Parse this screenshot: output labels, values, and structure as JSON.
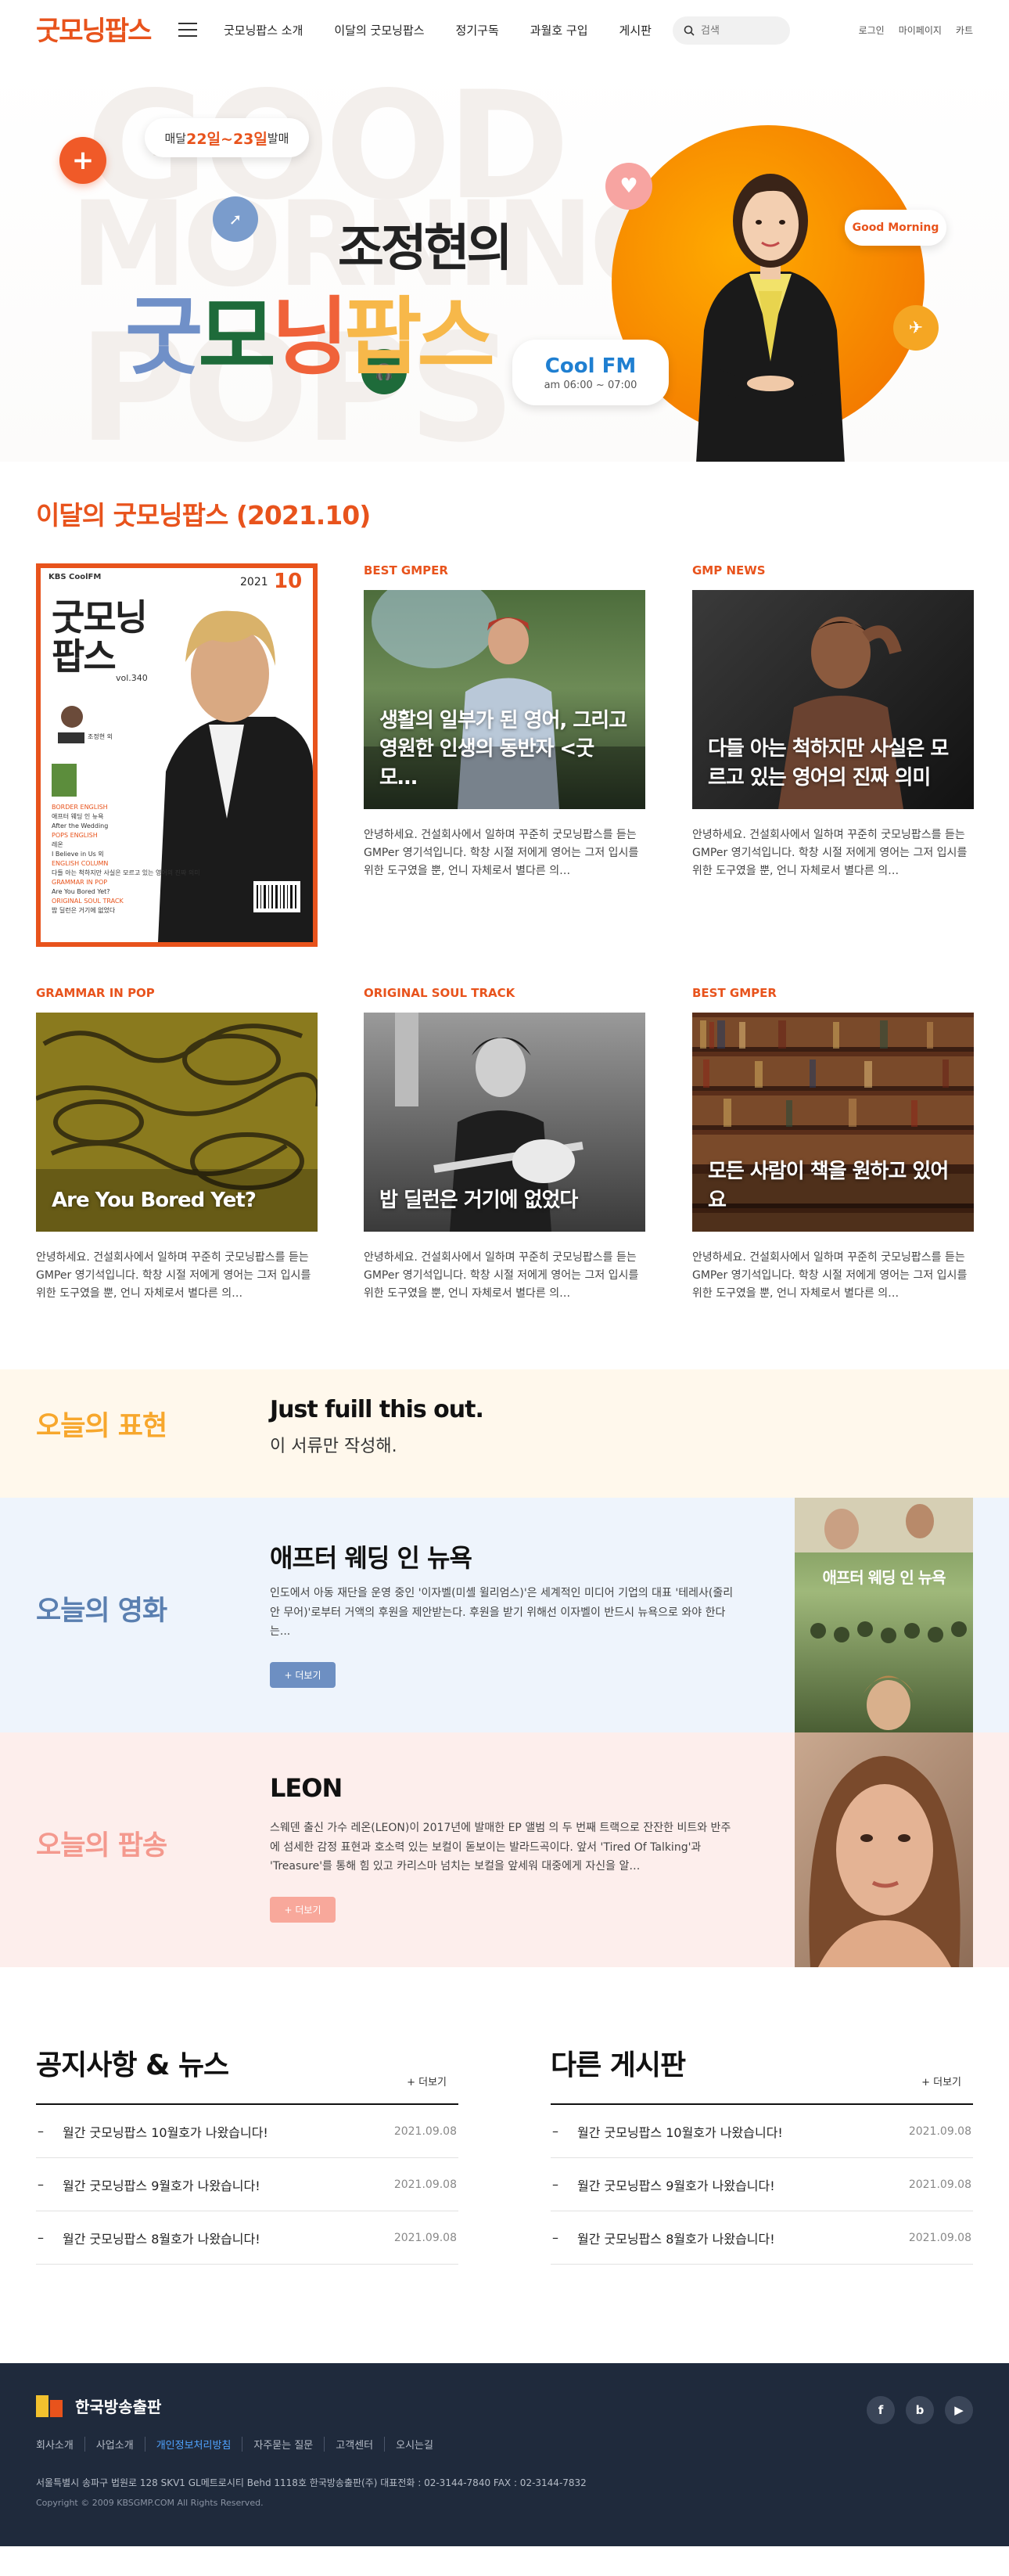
{
  "header": {
    "logo": "굿모닝팝스",
    "nav": [
      "굿모닝팝스 소개",
      "이달의 굿모닝팝스",
      "정기구독",
      "과월호 구입",
      "게시판"
    ],
    "search_placeholder": "검색",
    "util": [
      "로그인",
      "마이페이지",
      "카트"
    ]
  },
  "hero": {
    "badge_prefix": "매달 ",
    "badge_dates": "22일~23일",
    "badge_suffix": " 발매",
    "host_title": "조정현의",
    "show_title_1": "굿",
    "show_title_2": "모",
    "show_title_3": "닝",
    "show_title_4": "팝스",
    "good_morning": "Good Morning",
    "station": "Cool FM",
    "time": "am 06:00 ~ 07:00",
    "bg_words": [
      "GOOD",
      "MORNING",
      "POPS"
    ]
  },
  "monthly": {
    "title": "이달의 굿모닝팝스 (2021.10)",
    "magazine": {
      "kbs": "KBS CoolFM",
      "year": "2021",
      "month": "10",
      "title_1": "굿모닝",
      "title_2": "팝스",
      "vol": "vol.340",
      "host": "조정현 외",
      "toc": [
        "BORDER ENGLISH",
        "애프터 웨딩 인 뉴욕",
        "After the Wedding",
        "POPS ENGLISH",
        "레온",
        "I Believe in Us 외",
        "ENGLISH COLUMN",
        "다들 아는 척하지만 사실은 모르고 있는 영어의 진짜 의미",
        "GRAMMAR IN POP",
        "Are You Bored Yet?",
        "ORIGINAL SOUL TRACK",
        "밥 딜런은 거기에 없었다"
      ]
    },
    "cards": [
      {
        "category": "BEST GMPER",
        "caption": "생활의 일부가 된 영어, 그리고 영원한 인생의 동반자 <굿모…",
        "desc": "안녕하세요. 건설회사에서 일하며 꾸준히 굿모닝팝스를 듣는 GMPer 영기석입니다. 학창 시절 저에게 영어는 그저 입시를 위한 도구였을 뿐, 언니 자체로서 별다른 의…"
      },
      {
        "category": "GMP NEWS",
        "caption": "다들 아는 척하지만 사실은 모르고 있는 영어의 진짜 의미",
        "desc": "안녕하세요. 건설회사에서 일하며 꾸준히 굿모닝팝스를 듣는 GMPer 영기석입니다. 학창 시절 저에게 영어는 그저 입시를 위한 도구였을 뿐, 언니 자체로서 별다른 의…"
      },
      {
        "category": "GRAMMAR IN POP",
        "caption": "Are You Bored Yet?",
        "desc": "안녕하세요. 건설회사에서 일하며 꾸준히 굿모닝팝스를 듣는 GMPer 영기석입니다. 학창 시절 저에게 영어는 그저 입시를 위한 도구였을 뿐, 언니 자체로서 별다른 의…"
      },
      {
        "category": "ORIGINAL SOUL TRACK",
        "caption": "밥 딜런은 거기에 없었다",
        "desc": "안녕하세요. 건설회사에서 일하며 꾸준히 굿모닝팝스를 듣는 GMPer 영기석입니다. 학창 시절 저에게 영어는 그저 입시를 위한 도구였을 뿐, 언니 자체로서 별다른 의…"
      },
      {
        "category": "BEST GMPER",
        "caption": "모든 사람이 책을 원하고 있어요",
        "desc": "안녕하세요. 건설회사에서 일하며 꾸준히 굿모닝팝스를 듣는 GMPer 영기석입니다. 학창 시절 저에게 영어는 그저 입시를 위한 도구였을 뿐, 언니 자체로서 별다른 의…"
      }
    ]
  },
  "today": {
    "expression": {
      "label": "오늘의 표현",
      "english": "Just fuill this out.",
      "korean": "이 서류만 작성해."
    },
    "movie": {
      "label": "오늘의 영화",
      "title": "애프터 웨딩 인 뉴욕",
      "desc": "인도에서 아동 재단을 운영 중인 '이자벨(미셸 윌리엄스)'은 세계적인 미디어 기업의 대표 '테레사(줄리안 무어)'로부터 거액의 후원을 제안받는다. 후원을 받기 위해선 이자벨이 반드시 뉴욕으로 와야 한다는...",
      "more": "+ 더보기",
      "poster_text": "애프터 웨딩 인 뉴욕"
    },
    "song": {
      "label": "오늘의 팝송",
      "title": "LEON",
      "desc": "스웨덴 출신 가수 레온(LEON)이 2017년에 발매한 EP 앨범 의 두 번째 트랙으로 잔잔한 비트와 반주에 섬세한 감정 표현과 호소력 있는 보컬이 돋보이는 발라드곡이다. 앞서 'Tired Of Talking'과 'Treasure'를 통해 힘 있고 카리스마 넘치는 보컬을 앞세워 대중에게 자신을 알…",
      "more": "+ 더보기"
    }
  },
  "boards": [
    {
      "title": "공지사항 & 뉴스",
      "more": "+ 더보기",
      "rows": [
        {
          "text": "월간 굿모닝팝스 10월호가 나왔습니다!",
          "date": "2021.09.08"
        },
        {
          "text": "월간 굿모닝팝스 9월호가 나왔습니다!",
          "date": "2021.09.08"
        },
        {
          "text": "월간 굿모닝팝스 8월호가 나왔습니다!",
          "date": "2021.09.08"
        }
      ]
    },
    {
      "title": "다른 게시판",
      "more": "+ 더보기",
      "rows": [
        {
          "text": "월간 굿모닝팝스 10월호가 나왔습니다!",
          "date": "2021.09.08"
        },
        {
          "text": "월간 굿모닝팝스 9월호가 나왔습니다!",
          "date": "2021.09.08"
        },
        {
          "text": "월간 굿모닝팝스 8월호가 나왔습니다!",
          "date": "2021.09.08"
        }
      ]
    }
  ],
  "footer": {
    "company": "한국방송출판",
    "links": [
      "회사소개",
      "사업소개",
      "개인정보처리방침",
      "자주묻는 질문",
      "고객센터",
      "오시는길"
    ],
    "address": "서울특별시 송파구 법원로 128 SKV1 GL메트로시티 Behd 1118호 한국방송출판(주)    대표전화 : 02-3144-7840    FAX : 02-3144-7832",
    "copyright": "Copyright © 2009 KBSGMP.COM All Rights Reserved.",
    "sns": [
      "f",
      "b",
      "▶"
    ]
  },
  "colors": {
    "accent": "#e8531c",
    "expr_bg": "#fff8ec",
    "movie_bg": "#eef4fc",
    "song_bg": "#fdeeec",
    "footer_bg": "#1f2a3c"
  }
}
